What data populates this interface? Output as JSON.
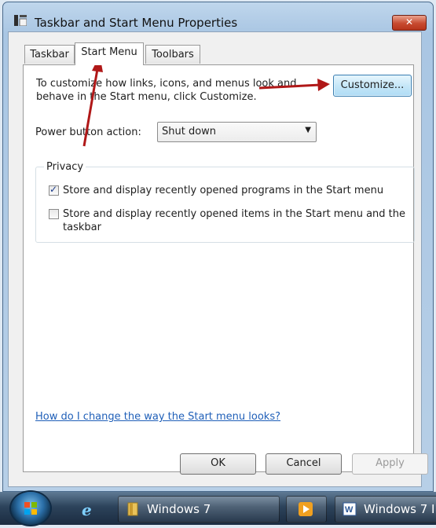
{
  "window": {
    "title": "Taskbar and Start Menu Properties",
    "close_label": "✕"
  },
  "tabs": [
    {
      "label": "Taskbar",
      "active": false
    },
    {
      "label": "Start Menu",
      "active": true
    },
    {
      "label": "Toolbars",
      "active": false
    }
  ],
  "start_menu": {
    "intro_line1": "To customize how links, icons, and menus look and",
    "intro_line2": "behave in the Start menu, click Customize.",
    "customize_label": "Customize...",
    "power_label": "Power button action:",
    "power_value": "Shut down",
    "privacy_legend": "Privacy",
    "privacy_items": [
      {
        "label_line1": "Store and display recently opened programs in the Start menu",
        "label_line2": "",
        "checked": true
      },
      {
        "label_line1": "Store and display recently opened items in the Start menu and the",
        "label_line2": "taskbar",
        "checked": false
      }
    ],
    "help_link": "How do I change the way the Start menu looks?"
  },
  "dialog_buttons": {
    "ok": "OK",
    "cancel": "Cancel",
    "apply": "Apply"
  },
  "taskbar": {
    "items": [
      {
        "label": "Windows 7"
      },
      {
        "label": ""
      },
      {
        "label": "Windows 7 I"
      }
    ]
  },
  "colors": {
    "annotation_arrow": "#b01818",
    "link": "#1f5fb8"
  }
}
